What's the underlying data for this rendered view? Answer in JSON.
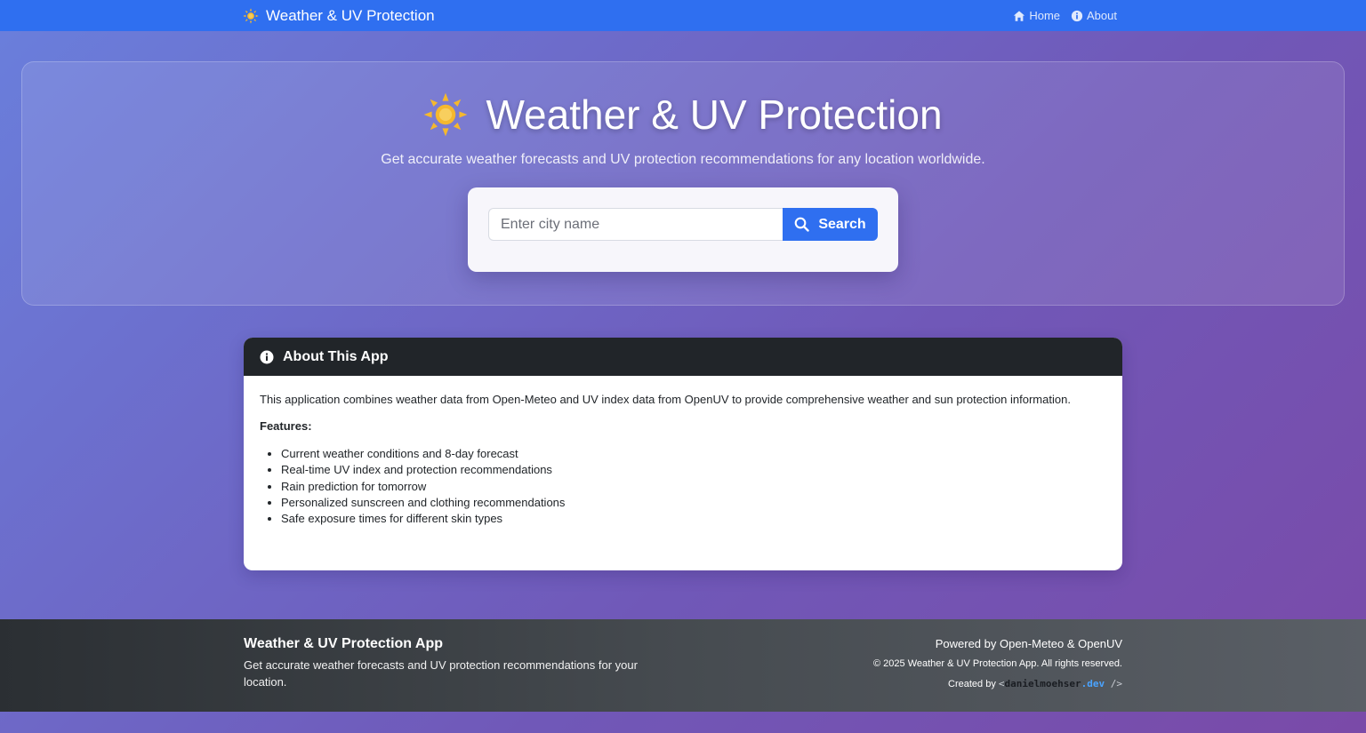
{
  "navbar": {
    "brand": "Weather & UV Protection",
    "links": [
      {
        "label": "Home",
        "icon": "home-icon"
      },
      {
        "label": "About",
        "icon": "info-icon"
      }
    ]
  },
  "hero": {
    "title": "Weather & UV Protection",
    "subtitle": "Get accurate weather forecasts and UV protection recommendations for any location worldwide.",
    "search": {
      "placeholder": "Enter city name",
      "button_label": "Search"
    }
  },
  "about": {
    "title": "About This App",
    "description": "This application combines weather data from Open-Meteo and UV index data from OpenUV to provide comprehensive weather and sun protection information.",
    "features_label": "Features:",
    "features": [
      "Current weather conditions and 8-day forecast",
      "Real-time UV index and protection recommendations",
      "Rain prediction for tomorrow",
      "Personalized sunscreen and clothing recommendations",
      "Safe exposure times for different skin types"
    ]
  },
  "footer": {
    "title": "Weather & UV Protection App",
    "description": "Get accurate weather forecasts and UV protection recommendations for your location.",
    "powered_by": "Powered by Open-Meteo & OpenUV",
    "copyright": "© 2025 Weather & UV Protection App. All rights reserved.",
    "created_by": "Created by",
    "creator": {
      "open": "<",
      "name": "danielmoehser",
      "tld": ".dev",
      "close": " />"
    }
  },
  "colors": {
    "navbar": "#2f6ff0",
    "accent": "#2f6ff0",
    "sun": "#f5b82e",
    "card_header": "#212529"
  }
}
